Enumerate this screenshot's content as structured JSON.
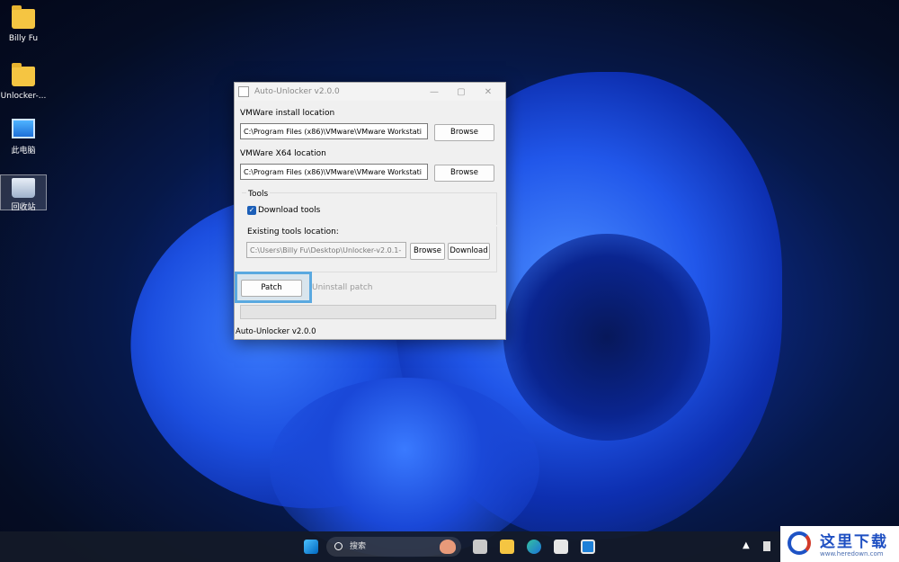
{
  "desktop": {
    "icons": [
      {
        "label": "Billy Fu",
        "icon": "folder-icon"
      },
      {
        "label": "Unlocker-...",
        "icon": "folder-zip-icon"
      },
      {
        "label": "此电脑",
        "icon": "computer-icon"
      },
      {
        "label": "回收站",
        "icon": "recycle-bin-icon"
      }
    ]
  },
  "window": {
    "title": "Auto-Unlocker v2.0.0",
    "controls": {
      "minimize": "—",
      "maximize": "▢",
      "close": "✕"
    },
    "install_label": "VMWare install location",
    "install_value": "C:\\Program Files (x86)\\VMware\\VMware Workstati",
    "x64_label": "VMWare X64 location",
    "x64_value": "C:\\Program Files (x86)\\VMware\\VMware Workstati",
    "browse_label": "Browse",
    "tools_group_label": "Tools",
    "download_tools_label": "Download tools",
    "download_tools_checked": true,
    "existing_tools_label": "Existing tools location:",
    "existing_tools_value": "C:\\Users\\Billy Fu\\Desktop\\Unlocker-v2.0.1-",
    "tools_browse_label": "Browse",
    "download_label": "Download",
    "patch_label": "Patch",
    "uninstall_label": "Uninstall patch",
    "status_text": "Auto-Unlocker v2.0.0"
  },
  "taskbar": {
    "search_placeholder": "搜索",
    "accent_color": "#5aa9e0"
  },
  "watermark": {
    "text": "这里下载",
    "url": "www.heredown.com"
  }
}
